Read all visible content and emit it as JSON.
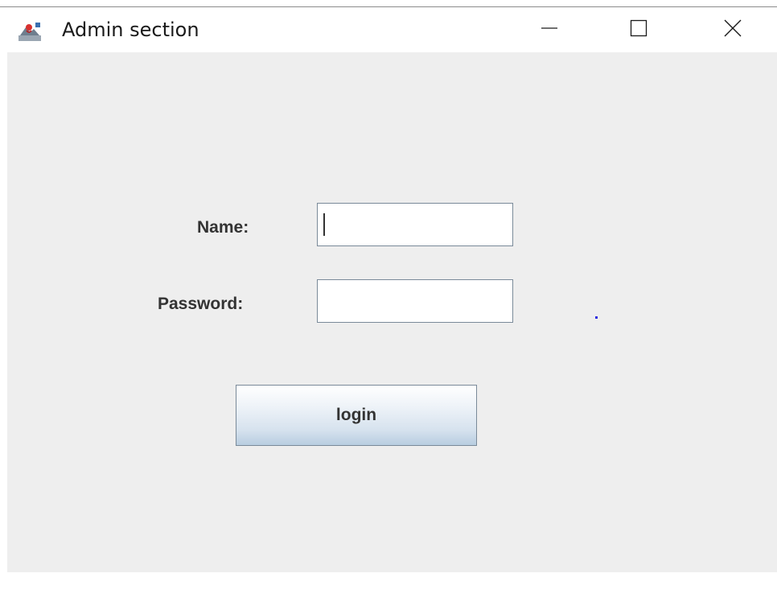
{
  "window": {
    "title": "Admin section",
    "app_icon": "java-cup-icon",
    "controls": {
      "minimize_icon": "minimize-icon",
      "maximize_icon": "maximize-icon",
      "close_icon": "close-icon"
    }
  },
  "form": {
    "name_label": "Name:",
    "name_value": "",
    "password_label": "Password:",
    "password_value": "",
    "login_label": "login"
  },
  "colors": {
    "content_background": "#eeeeee",
    "button_gradient_top": "#ffffff",
    "button_gradient_bottom": "#b8cde0",
    "stray_dot": "#2a2ae0"
  }
}
